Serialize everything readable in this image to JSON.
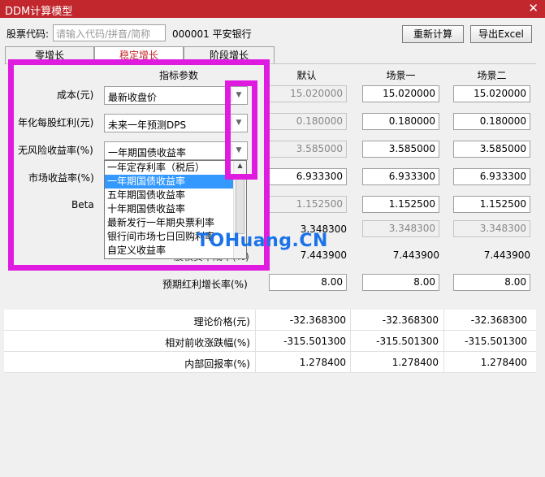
{
  "window": {
    "title": "DDM计算模型",
    "close": "✕"
  },
  "stock": {
    "label": "股票代码:",
    "placeholder": "请输入代码/拼音/简称",
    "name": "000001 平安银行"
  },
  "buttons": {
    "recalc": "重新计算",
    "export": "导出Excel"
  },
  "tabs": [
    "零增长",
    "稳定增长",
    "阶段增长"
  ],
  "headers": {
    "param": "指标参数",
    "default": "默认",
    "scenario1": "场景一",
    "scenario2": "场景二"
  },
  "rows": {
    "cost": {
      "label": "成本(元)",
      "combo": "最新收盘价",
      "default": "15.020000",
      "s1": "15.020000",
      "s2": "15.020000"
    },
    "dividend": {
      "label": "年化每股红利(元)",
      "combo": "未来一年预测DPS",
      "default": "0.180000",
      "s1": "0.180000",
      "s2": "0.180000"
    },
    "riskfree": {
      "label": "无风险收益率(%)",
      "combo": "一年期国债收益率",
      "default": "3.585000",
      "s1": "3.585000",
      "s2": "3.585000"
    },
    "market": {
      "label": "市场收益率(%)",
      "combo": "一年定存利率（税后）",
      "default": "6.933300",
      "s1": "6.933300",
      "s2": "6.933300"
    },
    "beta": {
      "label": "Beta",
      "default": "1.152500",
      "s1": "1.152500",
      "s2": "1.152500"
    },
    "row6": {
      "default": "3.348300",
      "s1": "3.348300",
      "s2": "3.348300"
    },
    "row7": {
      "label_partial": "股权资本成本(%)",
      "default": "7.443900",
      "s1": "7.443900",
      "s2": "7.443900"
    },
    "growth": {
      "label": "预期红利增长率(%)",
      "default": "8.00",
      "s1": "8.00",
      "s2": "8.00"
    }
  },
  "dropdown": {
    "items": [
      "一年定存利率（税后）",
      "一年期国债收益率",
      "五年期国债收益率",
      "十年期国债收益率",
      "最新发行一年期央票利率",
      "银行间市场七日回购利率",
      "自定义收益率"
    ],
    "selected": "一年期国债收益率"
  },
  "results": [
    {
      "label": "理论价格(元)",
      "default": "-32.368300",
      "s1": "-32.368300",
      "s2": "-32.368300"
    },
    {
      "label": "相对前收涨跌幅(%)",
      "default": "-315.501300",
      "s1": "-315.501300",
      "s2": "-315.501300"
    },
    {
      "label": "内部回报率(%)",
      "default": "1.278400",
      "s1": "1.278400",
      "s2": "1.278400"
    }
  ],
  "watermark": "TOHuang.CN",
  "colors": {
    "titlebar": "#c1272d",
    "highlight": "#e01be0",
    "selection": "#3399ff",
    "watermark": "#1a73e8"
  }
}
